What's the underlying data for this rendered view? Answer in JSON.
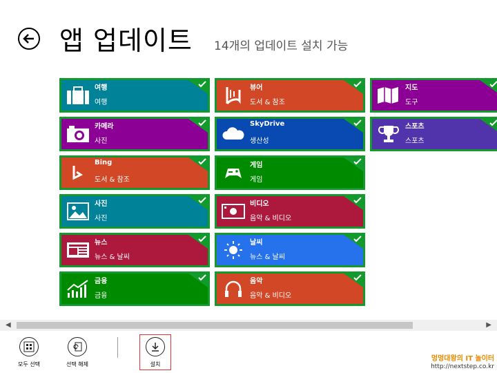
{
  "header": {
    "title": "앱 업데이트",
    "subtitle": "14개의 업데이트 설치 가능"
  },
  "colors": {
    "border_green": "#139a2c",
    "teal": "#008299",
    "orange": "#d24726",
    "purple": "#8c0095",
    "blue": "#094ab2",
    "violet": "#5133ab",
    "crimson": "#ac193d",
    "sky": "#2672ec"
  },
  "tiles": [
    {
      "name": "여행",
      "category": "여행",
      "icon": "briefcase-icon",
      "color": "#008299"
    },
    {
      "name": "카메라",
      "category": "사진",
      "icon": "camera-icon",
      "color": "#8c0095"
    },
    {
      "name": "Bing",
      "category": "도서 & 참조",
      "icon": "bing-icon",
      "color": "#d24726"
    },
    {
      "name": "사진",
      "category": "사진",
      "icon": "photo-icon",
      "color": "#008299"
    },
    {
      "name": "뉴스",
      "category": "뉴스 & 날씨",
      "icon": "newspaper-icon",
      "color": "#ac193d"
    },
    {
      "name": "금융",
      "category": "금융",
      "icon": "chart-icon",
      "color": "#008a00"
    },
    {
      "name": "뷰어",
      "category": "도서 & 참조",
      "icon": "reader-icon",
      "color": "#d24726"
    },
    {
      "name": "SkyDrive",
      "category": "생산성",
      "icon": "cloud-icon",
      "color": "#094ab2"
    },
    {
      "name": "게임",
      "category": "게임",
      "icon": "gamepad-icon",
      "color": "#008a00"
    },
    {
      "name": "비디오",
      "category": "음악 & 비디오",
      "icon": "video-icon",
      "color": "#ac193d"
    },
    {
      "name": "날씨",
      "category": "뉴스 & 날씨",
      "icon": "sun-icon",
      "color": "#2672ec"
    },
    {
      "name": "음악",
      "category": "음악 & 비디오",
      "icon": "headphones-icon",
      "color": "#d24726"
    },
    {
      "name": "지도",
      "category": "도구",
      "icon": "map-icon",
      "color": "#8c0095"
    },
    {
      "name": "스포츠",
      "category": "스포츠",
      "icon": "trophy-icon",
      "color": "#5133ab"
    }
  ],
  "appbar": {
    "select_all": "모두 선택",
    "deselect": "선택 해제",
    "install": "설치"
  },
  "watermark": {
    "line1": "멍멍대왕의 IT 놀이터",
    "line2": "http://nextstep.co.kr"
  }
}
